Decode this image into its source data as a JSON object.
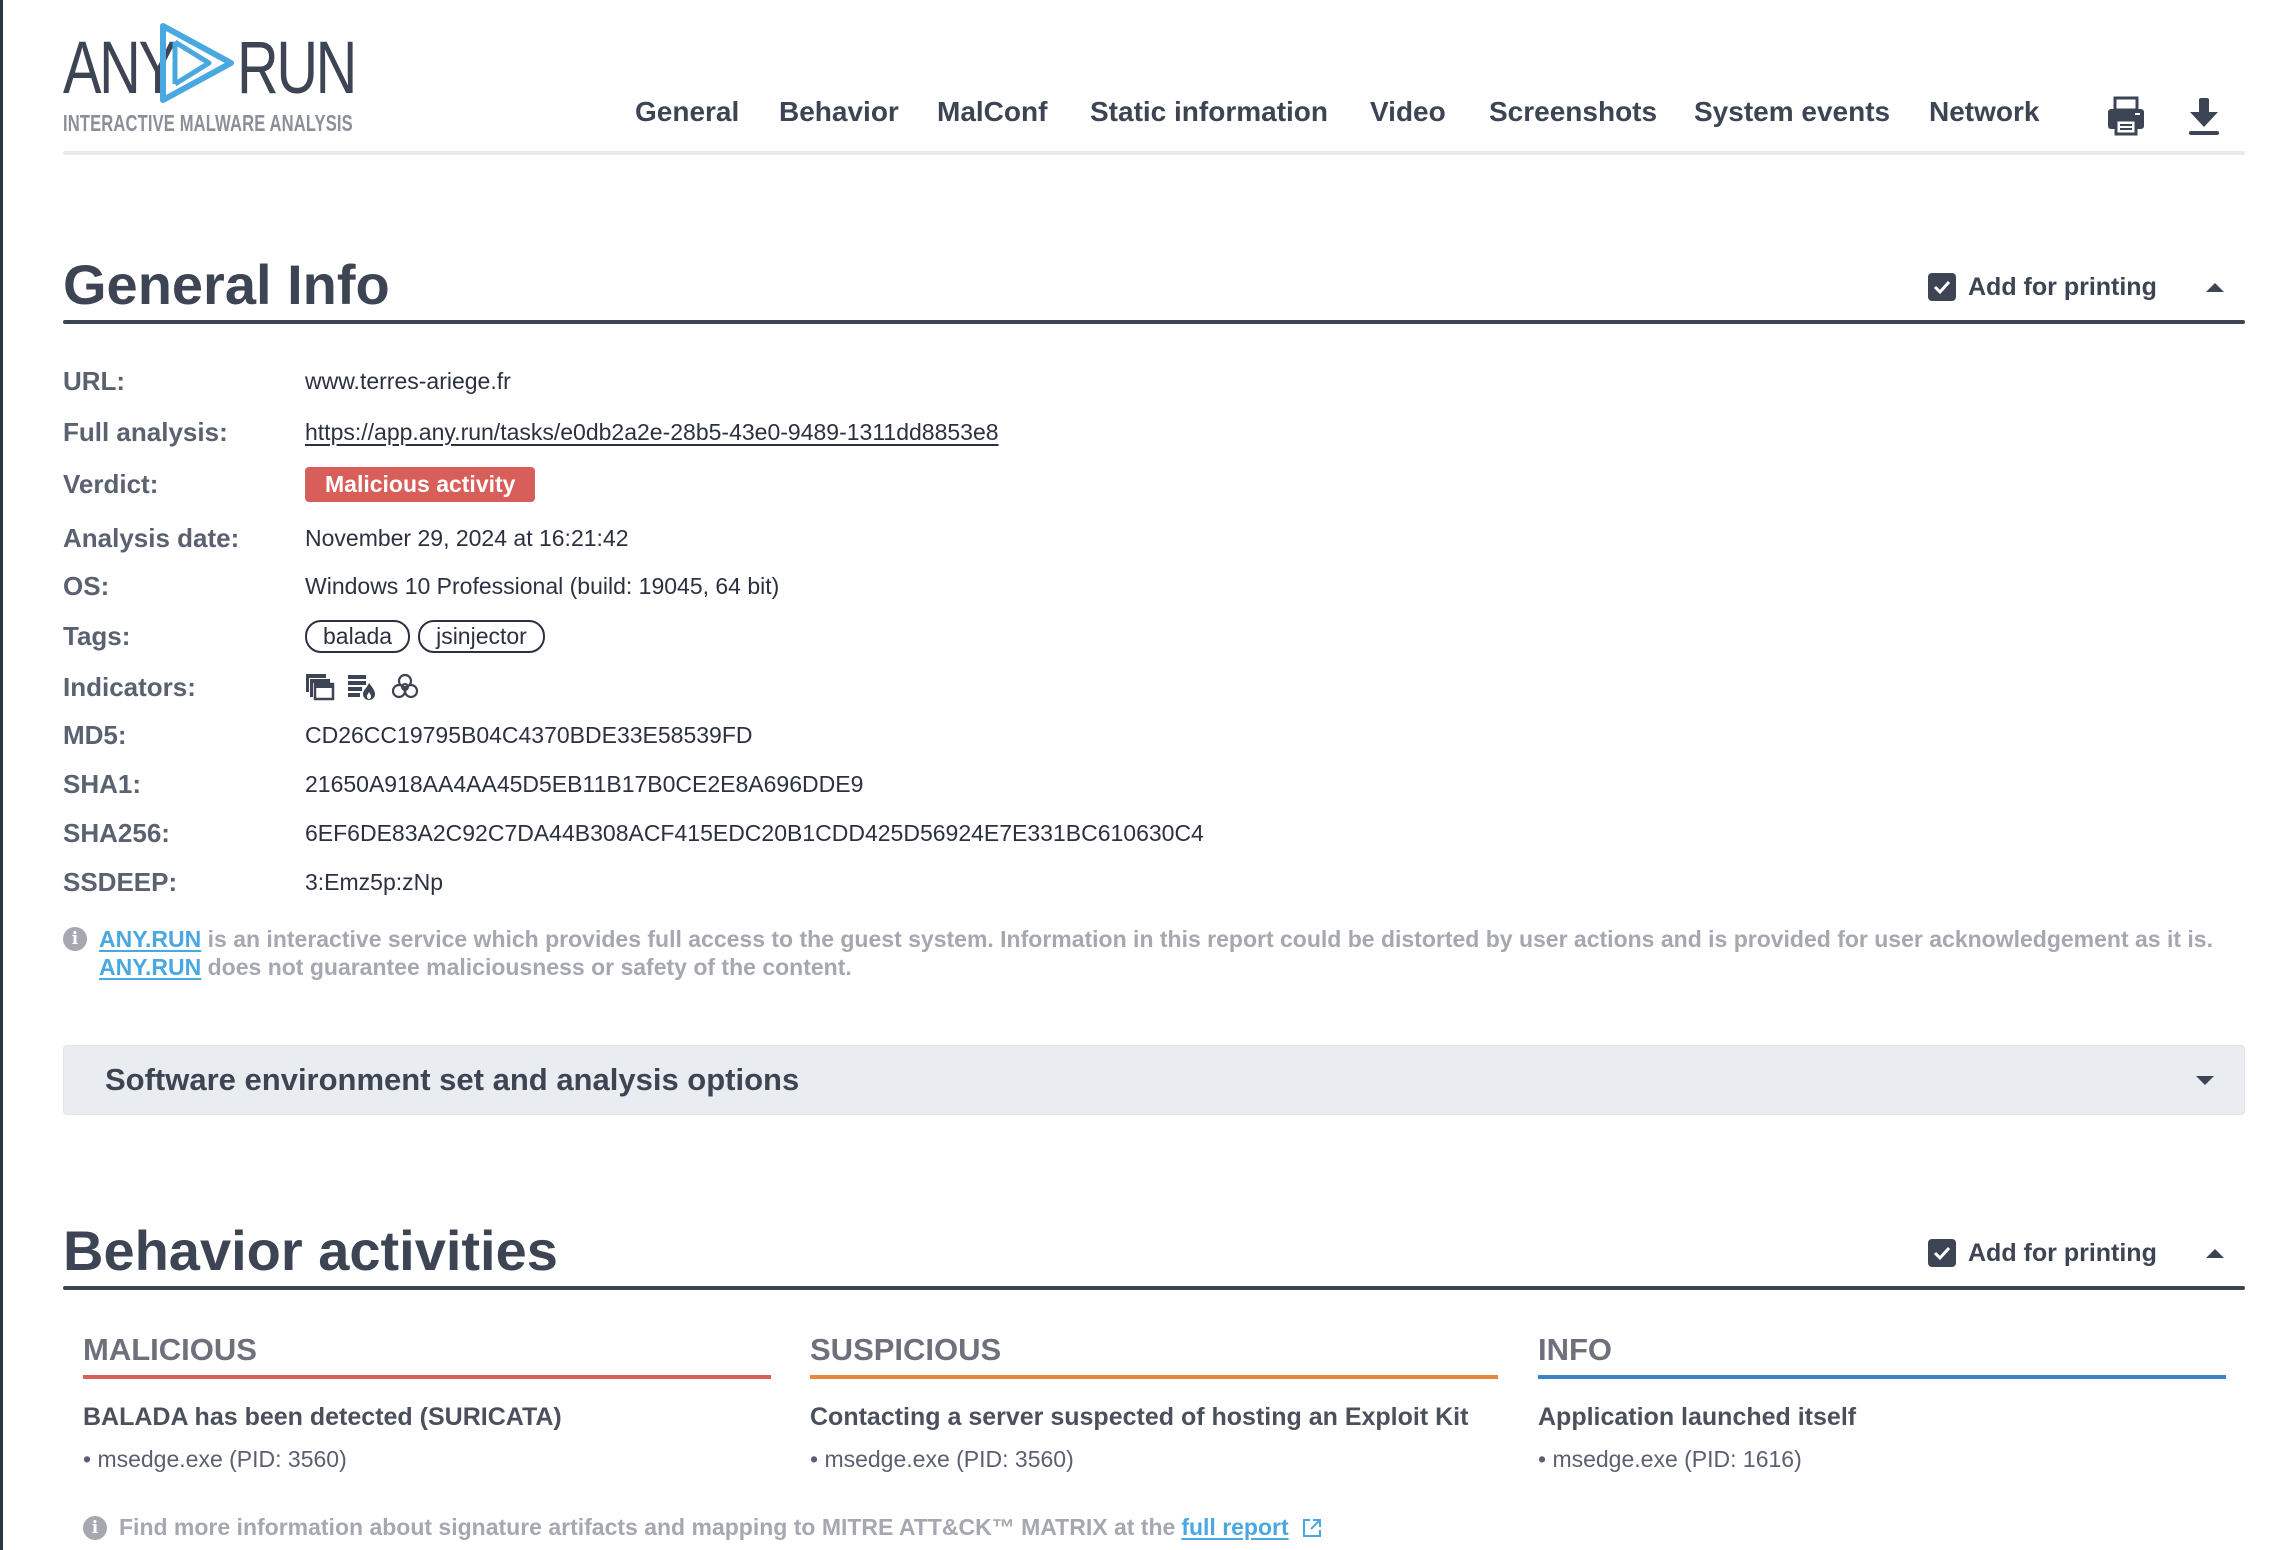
{
  "brand": {
    "word_left": "ANY",
    "word_right": "RUN",
    "tagline": "INTERACTIVE MALWARE ANALYSIS",
    "accent_color": "#4aa8e0",
    "logo_icon": "play-triangle-icon"
  },
  "nav": {
    "items": [
      {
        "label": "General"
      },
      {
        "label": "Behavior"
      },
      {
        "label": "MalConf"
      },
      {
        "label": "Static information"
      },
      {
        "label": "Video"
      },
      {
        "label": "Screenshots"
      },
      {
        "label": "System events"
      },
      {
        "label": "Network"
      }
    ],
    "print_icon": "printer-icon",
    "download_icon": "download-icon"
  },
  "general_info": {
    "title": "General Info",
    "print_label": "Add for printing",
    "print_checked": true,
    "rows": {
      "url": {
        "label": "URL:",
        "value": "www.terres-ariege.fr"
      },
      "full_analysis": {
        "label": "Full analysis:",
        "value": "https://app.any.run/tasks/e0db2a2e-28b5-43e0-9489-1311dd8853e8"
      },
      "verdict": {
        "label": "Verdict:",
        "value": "Malicious activity",
        "color": "#d85f59"
      },
      "analysis_date": {
        "label": "Analysis date:",
        "value": "November 29, 2024 at 16:21:42"
      },
      "os": {
        "label": "OS:",
        "value": "Windows 10 Professional (build: 19045, 64 bit)"
      },
      "tags": {
        "label": "Tags:",
        "values": [
          "balada",
          "jsinjector"
        ]
      },
      "indicators": {
        "label": "Indicators:",
        "icons": [
          "multiple-windows-icon",
          "firewall-fire-icon",
          "biohazard-icon"
        ]
      },
      "md5": {
        "label": "MD5:",
        "value": "CD26CC19795B04C4370BDE33E58539FD"
      },
      "sha1": {
        "label": "SHA1:",
        "value": "21650A918AA4AA45D5EB11B17B0CE2E8A696DDE9"
      },
      "sha256": {
        "label": "SHA256:",
        "value": "6EF6DE83A2C92C7DA44B308ACF415EDC20B1CDD425D56924E7E331BC610630C4"
      },
      "ssdeep": {
        "label": "SSDEEP:",
        "value": "3:Emz5p:zNp"
      }
    },
    "note": {
      "link_text": "ANY.RUN",
      "line1": " is an interactive service which provides full access to the guest system. Information in this report could be distorted by user actions and is provided for user acknowledgement as it is.",
      "line2": " does not guarantee maliciousness or safety of the content."
    }
  },
  "software_env": {
    "title": "Software environment set and analysis options",
    "expanded": false
  },
  "behavior": {
    "title": "Behavior activities",
    "print_label": "Add for printing",
    "print_checked": true,
    "columns": [
      {
        "heading": "MALICIOUS",
        "color": "#d85f59",
        "title": "BALADA has been detected (SURICATA)",
        "item": "• msedge.exe (PID: 3560)"
      },
      {
        "heading": "SUSPICIOUS",
        "color": "#e8873a",
        "title": "Contacting a server suspected of hosting an Exploit Kit",
        "item": "• msedge.exe (PID: 3560)"
      },
      {
        "heading": "INFO",
        "color": "#3b82c4",
        "title": "Application launched itself",
        "item": "• msedge.exe (PID: 1616)"
      }
    ],
    "footer": {
      "text": "Find more information about signature artifacts and mapping to MITRE ATT&CK™ MATRIX at the ",
      "link_text": "full report"
    }
  }
}
